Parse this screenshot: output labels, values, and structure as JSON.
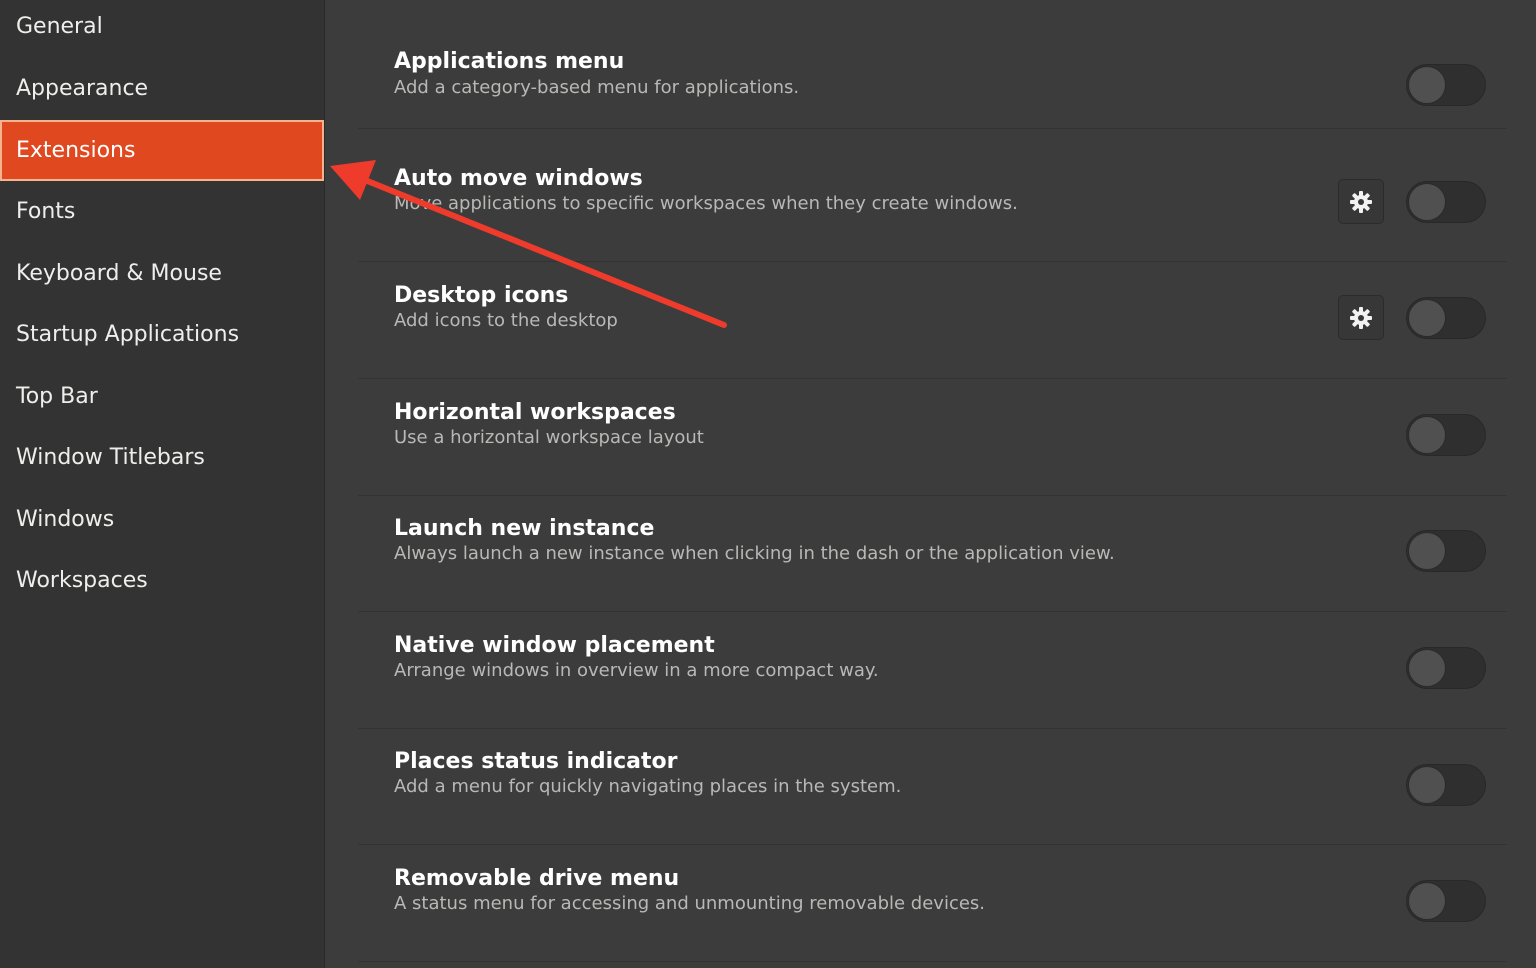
{
  "sidebar": {
    "items": [
      {
        "label": "General",
        "selected": false
      },
      {
        "label": "Appearance",
        "selected": false
      },
      {
        "label": "Extensions",
        "selected": true
      },
      {
        "label": "Fonts",
        "selected": false
      },
      {
        "label": "Keyboard & Mouse",
        "selected": false
      },
      {
        "label": "Startup Applications",
        "selected": false
      },
      {
        "label": "Top Bar",
        "selected": false
      },
      {
        "label": "Window Titlebars",
        "selected": false
      },
      {
        "label": "Windows",
        "selected": false
      },
      {
        "label": "Workspaces",
        "selected": false
      }
    ]
  },
  "extensions": [
    {
      "title": "Applications menu",
      "description": "Add a category-based menu for applications.",
      "has_settings": false,
      "enabled": false
    },
    {
      "title": "Auto move windows",
      "description": "Move applications to specific workspaces when they create windows.",
      "has_settings": true,
      "enabled": false
    },
    {
      "title": "Desktop icons",
      "description": "Add icons to the desktop",
      "has_settings": true,
      "enabled": false
    },
    {
      "title": "Horizontal workspaces",
      "description": "Use a horizontal workspace layout",
      "has_settings": false,
      "enabled": false
    },
    {
      "title": "Launch new instance",
      "description": "Always launch a new instance when clicking in the dash or the application view.",
      "has_settings": false,
      "enabled": false
    },
    {
      "title": "Native window placement",
      "description": "Arrange windows in overview in a more compact way.",
      "has_settings": false,
      "enabled": false
    },
    {
      "title": "Places status indicator",
      "description": "Add a menu for quickly navigating places in the system.",
      "has_settings": false,
      "enabled": false
    },
    {
      "title": "Removable drive menu",
      "description": "A status menu for accessing and unmounting removable devices.",
      "has_settings": false,
      "enabled": false
    }
  ],
  "icons": {
    "settings": "gear-icon"
  },
  "colors": {
    "accent": "#e0491f",
    "annotation_arrow": "#ee3b2b",
    "sidebar_bg": "#333333",
    "main_bg": "#3c3c3c"
  }
}
